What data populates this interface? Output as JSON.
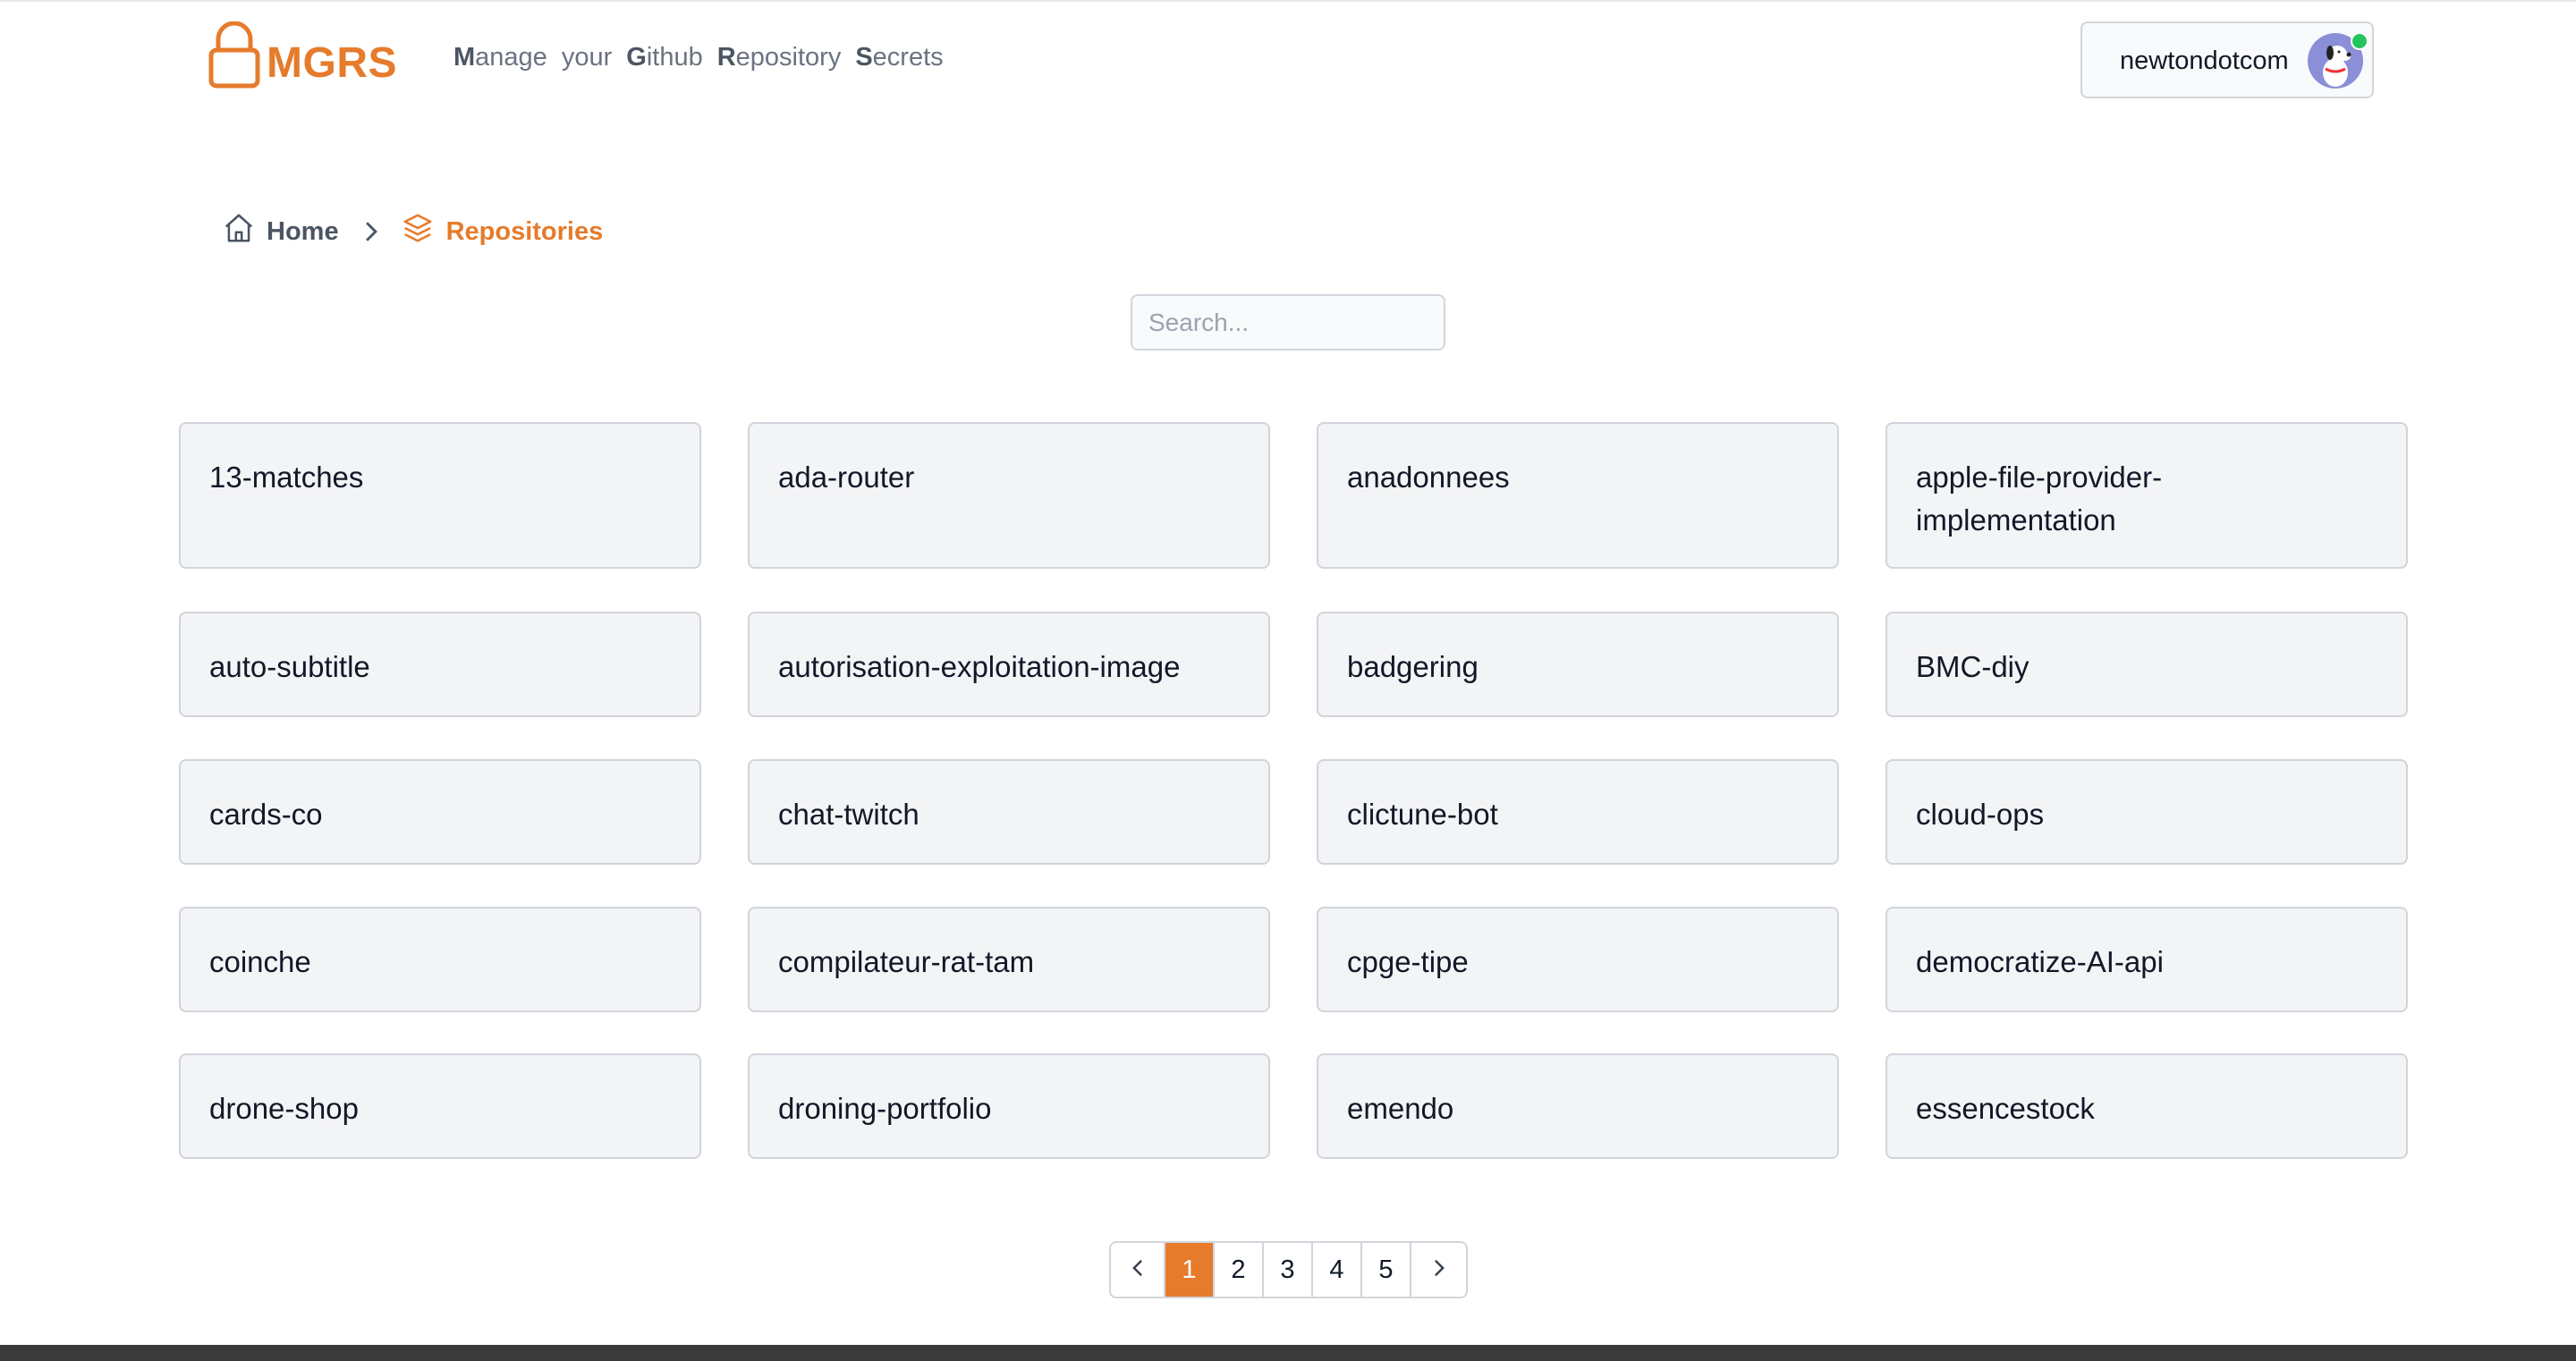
{
  "header": {
    "logo_text": "MGRS",
    "tagline": [
      {
        "initial": "M",
        "rest": "anage"
      },
      {
        "initial": "",
        "rest": "your"
      },
      {
        "initial": "G",
        "rest": "ithub"
      },
      {
        "initial": "R",
        "rest": "epository"
      },
      {
        "initial": "S",
        "rest": "ecrets"
      }
    ],
    "username": "newtondotcom",
    "user_status": "online"
  },
  "breadcrumb": {
    "home_label": "Home",
    "current_label": "Repositories"
  },
  "search": {
    "placeholder": "Search...",
    "value": ""
  },
  "repositories": [
    "13-matches",
    "ada-router",
    "anadonnees",
    "apple-file-provider-implementation",
    "auto-subtitle",
    "autorisation-exploitation-image",
    "badgering",
    "BMC-diy",
    "cards-co",
    "chat-twitch",
    "clictune-bot",
    "cloud-ops",
    "coinche",
    "compilateur-rat-tam",
    "cpge-tipe",
    "democratize-AI-api",
    "drone-shop",
    "droning-portfolio",
    "emendo",
    "essencestock"
  ],
  "pagination": {
    "pages": [
      "1",
      "2",
      "3",
      "4",
      "5"
    ],
    "current_page": "1"
  },
  "colors": {
    "accent": "#e57b2b",
    "card_bg": "#f3f4f6",
    "border": "#d1d5db",
    "online": "#22c55e"
  },
  "icons": {
    "logo": "lock-icon",
    "home": "home-icon",
    "separator": "chevron-right-icon",
    "repositories": "layers-icon",
    "prev": "chevron-left-icon",
    "next": "chevron-right-icon"
  }
}
